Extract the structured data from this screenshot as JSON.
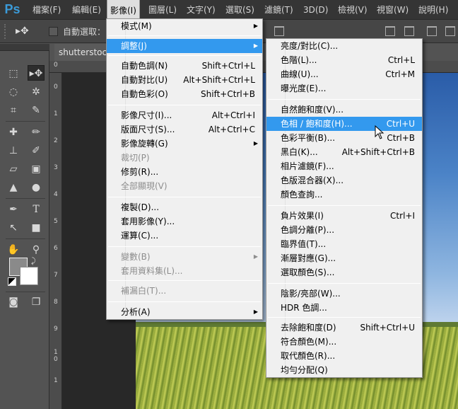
{
  "app": {
    "logo": "Ps"
  },
  "menubar": {
    "items": [
      "檔案(F)",
      "編輯(E)",
      "影像(I)",
      "圖層(L)",
      "文字(Y)",
      "選取(S)",
      "濾鏡(T)",
      "3D(D)",
      "檢視(V)",
      "視窗(W)",
      "說明(H)"
    ],
    "active": "影像(I)"
  },
  "options": {
    "auto_select_label": "自動選取："
  },
  "document": {
    "tab_title": "shutterstock",
    "ruler_top": [
      "0"
    ],
    "ruler_left": [
      "0",
      "1",
      "2",
      "3",
      "4",
      "5",
      "6",
      "7",
      "8",
      "9",
      "1",
      "0",
      "1"
    ]
  },
  "image_menu": {
    "items": [
      {
        "label": "模式(M)",
        "submenu": true
      },
      {
        "label": "調整(J)",
        "submenu": true,
        "highlighted": true
      },
      {
        "label": "自動色調(N)",
        "shortcut": "Shift+Ctrl+L"
      },
      {
        "label": "自動對比(U)",
        "shortcut": "Alt+Shift+Ctrl+L"
      },
      {
        "label": "自動色彩(O)",
        "shortcut": "Shift+Ctrl+B"
      },
      {
        "label": "影像尺寸(I)...",
        "shortcut": "Alt+Ctrl+I"
      },
      {
        "label": "版面尺寸(S)...",
        "shortcut": "Alt+Ctrl+C"
      },
      {
        "label": "影像旋轉(G)",
        "submenu": true
      },
      {
        "label": "裁切(P)",
        "disabled": true
      },
      {
        "label": "修剪(R)..."
      },
      {
        "label": "全部顯現(V)",
        "disabled": true
      },
      {
        "label": "複製(D)..."
      },
      {
        "label": "套用影像(Y)..."
      },
      {
        "label": "運算(C)..."
      },
      {
        "label": "變數(B)",
        "submenu": true,
        "disabled": true
      },
      {
        "label": "套用資料集(L)...",
        "disabled": true
      },
      {
        "label": "補漏白(T)...",
        "disabled": true
      },
      {
        "label": "分析(A)",
        "submenu": true
      }
    ]
  },
  "adjust_menu": {
    "items": [
      {
        "label": "亮度/對比(C)..."
      },
      {
        "label": "色階(L)...",
        "shortcut": "Ctrl+L"
      },
      {
        "label": "曲線(U)...",
        "shortcut": "Ctrl+M"
      },
      {
        "label": "曝光度(E)..."
      },
      {
        "label": "自然飽和度(V)..."
      },
      {
        "label": "色相 / 飽和度(H)...",
        "shortcut": "Ctrl+U",
        "highlighted": true
      },
      {
        "label": "色彩平衡(B)...",
        "shortcut": "Ctrl+B"
      },
      {
        "label": "黑白(K)...",
        "shortcut": "Alt+Shift+Ctrl+B"
      },
      {
        "label": "相片濾鏡(F)..."
      },
      {
        "label": "色版混合器(X)..."
      },
      {
        "label": "顏色查詢..."
      },
      {
        "label": "負片效果(I)",
        "shortcut": "Ctrl+I"
      },
      {
        "label": "色調分離(P)..."
      },
      {
        "label": "臨界值(T)..."
      },
      {
        "label": "漸層對應(G)..."
      },
      {
        "label": "選取顏色(S)..."
      },
      {
        "label": "陰影/亮部(W)..."
      },
      {
        "label": "HDR 色調..."
      },
      {
        "label": "去除飽和度(D)",
        "shortcut": "Shift+Ctrl+U"
      },
      {
        "label": "符合顏色(M)..."
      },
      {
        "label": "取代顏色(R)..."
      },
      {
        "label": "均勻分配(Q)"
      }
    ]
  },
  "colors": {
    "highlight": "#3399ee",
    "menu_bg": "#f0f0f0",
    "ps_blue": "#3b9bd9"
  }
}
